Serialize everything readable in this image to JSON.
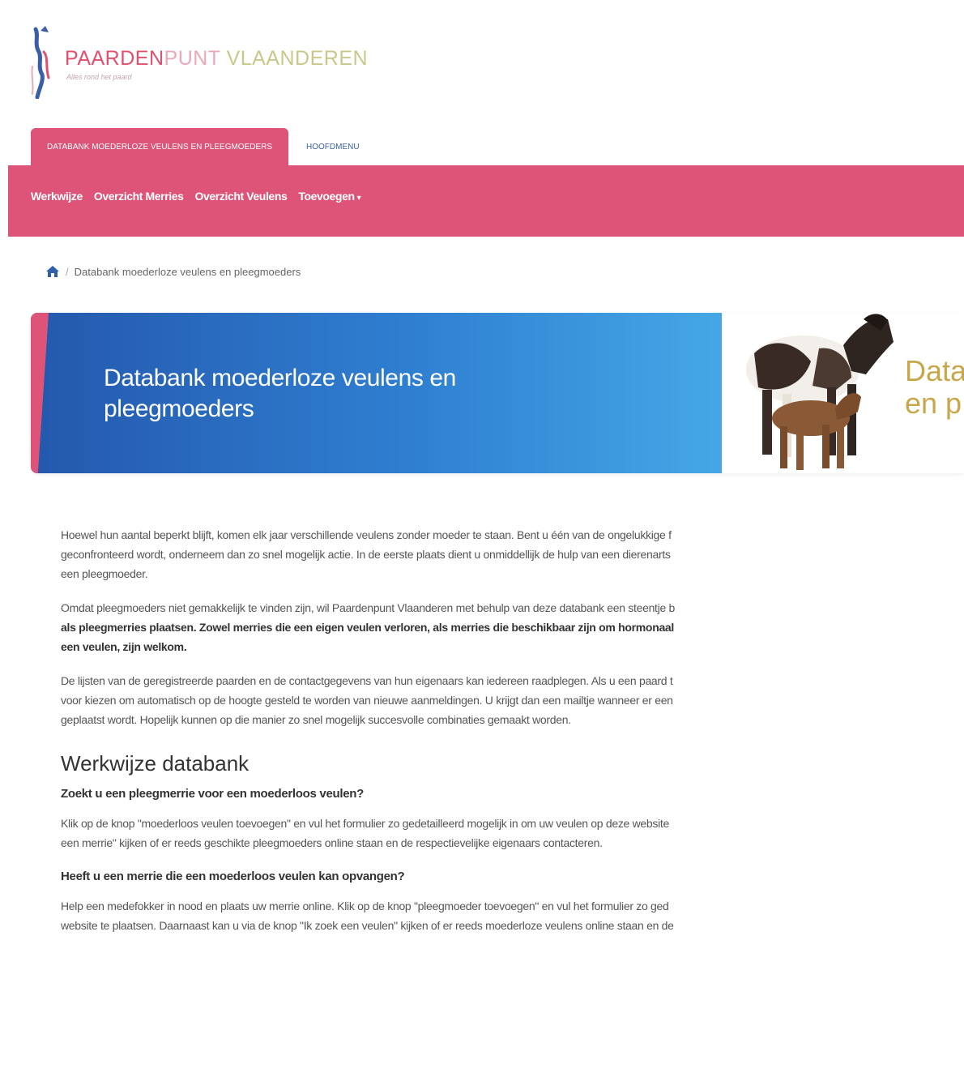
{
  "brand": {
    "name_part1": "PAARDEN",
    "name_part2": "PUNT ",
    "name_part3": "VLAANDEREN",
    "tagline": "Alles rond het paard",
    "colors": {
      "primary": "#dd5478",
      "secondary": "#e9a9b8",
      "tertiary": "#c9c88a"
    }
  },
  "tabs": {
    "active": "DATABANK MOEDERLOZE VEULENS EN PLEEGMOEDERS",
    "other": "HOOFDMENU"
  },
  "nav": {
    "items": [
      "Werkwijze",
      "Overzicht Merries",
      "Overzicht Veulens",
      "Toevoegen"
    ],
    "dropdown_caret": "▾"
  },
  "breadcrumb": {
    "separator": "/",
    "current": "Databank moederloze veulens en pleegmoeders"
  },
  "hero": {
    "title": "Databank moederloze veulens en pleegmoeders",
    "right_title_line1": "Data",
    "right_title_line2": "en p",
    "colors": {
      "gradient_start": "#2458ad",
      "gradient_end": "#45a7e6",
      "accent": "#dd5478"
    }
  },
  "content": {
    "p1": [
      "Hoewel hun aantal beperkt blijft, komen elk jaar verschillende veulens zonder moeder te staan. Bent u één van de ongelukkige f",
      "geconfronteerd wordt, onderneem dan zo snel mogelijk actie. In de eerste plaats dient u onmiddellijk de hulp van een dierenarts",
      "een pleegmoeder."
    ],
    "p2_line1": "Omdat pleegmoeders niet gemakkelijk te vinden zijn, wil Paardenpunt Vlaanderen met behulp van deze databank een steentje b",
    "p2_line2_bold": "als pleegmerries plaatsen. Zowel merries die een eigen veulen verloren, als merries die beschikbaar zijn om hormonaal",
    "p2_line3_bold": "een veulen, zijn welkom.",
    "p3": [
      "De lijsten van de geregistreerde paarden en de contactgegevens van hun eigenaars kan iedereen raadplegen. Als u een paard t",
      "voor kiezen om automatisch op de hoogte gesteld te worden van nieuwe aanmeldingen. U krijgt dan een mailtje wanneer er een",
      "geplaatst wordt. Hopelijk kunnen op die manier zo snel mogelijk succesvolle combinaties gemaakt worden."
    ],
    "heading": "Werkwijze databank",
    "q1": "Zoekt u een pleegmerrie voor een moederloos veulen?",
    "a1": [
      "Klik op de knop \"moederloos veulen toevoegen\" en vul het formulier zo gedetailleerd mogelijk in om uw veulen op deze website",
      "een merrie\" kijken of er reeds geschikte pleegmoeders online staan en de respectievelijke eigenaars contacteren."
    ],
    "q2": "Heeft u een merrie die een moederloos veulen kan opvangen?",
    "a2": [
      "Help een medefokker in nood en plaats uw merrie online. Klik op de knop \"pleegmoeder toevoegen\" en vul het formulier zo ged",
      "website te plaatsen. Daarnaast kan u via de knop \"Ik zoek een veulen\" kijken of er reeds moederloze veulens online staan en de"
    ]
  }
}
